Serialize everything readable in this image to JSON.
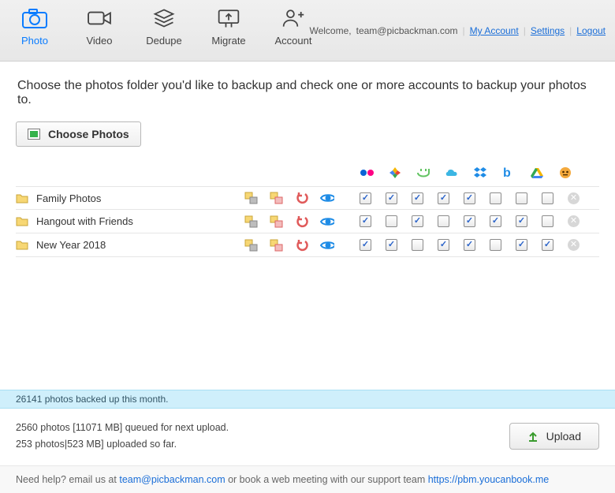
{
  "toolbar": {
    "tabs": [
      {
        "id": "photo",
        "label": "Photo",
        "active": true
      },
      {
        "id": "video",
        "label": "Video",
        "active": false
      },
      {
        "id": "dedupe",
        "label": "Dedupe",
        "active": false
      },
      {
        "id": "migrate",
        "label": "Migrate",
        "active": false
      },
      {
        "id": "account",
        "label": "Account",
        "active": false
      }
    ]
  },
  "top_right": {
    "welcome": "Welcome,",
    "email": "team@picbackman.com",
    "links": {
      "my_account": "My Account",
      "settings": "Settings",
      "logout": "Logout"
    }
  },
  "instruction": "Choose the photos folder you'd like to backup and check one or more accounts to backup your photos to.",
  "choose_button": "Choose Photos",
  "services": [
    {
      "id": "flickr",
      "name": "flickr-icon"
    },
    {
      "id": "google",
      "name": "google-photos-icon"
    },
    {
      "id": "smugmug",
      "name": "smugmug-icon"
    },
    {
      "id": "skydrive",
      "name": "skydrive-icon"
    },
    {
      "id": "dropbox",
      "name": "dropbox-icon"
    },
    {
      "id": "box",
      "name": "box-icon"
    },
    {
      "id": "drive",
      "name": "google-drive-icon"
    },
    {
      "id": "picmonkey",
      "name": "pic-icon"
    }
  ],
  "folders": [
    {
      "name": "Family Photos",
      "checks": [
        true,
        true,
        true,
        true,
        true,
        false,
        false,
        false
      ]
    },
    {
      "name": "Hangout with Friends",
      "checks": [
        true,
        false,
        true,
        false,
        true,
        true,
        true,
        false
      ]
    },
    {
      "name": "New Year 2018",
      "checks": [
        true,
        true,
        false,
        true,
        true,
        false,
        true,
        true
      ]
    }
  ],
  "footer": {
    "month_status": "26141 photos backed up this month.",
    "queue_line": "2560 photos [11071 MB] queued for next upload.",
    "uploaded_line": "253 photos|523 MB] uploaded so far.",
    "upload_button": "Upload",
    "help_prefix": "Need help? email us at ",
    "help_email": "team@picbackman.com",
    "help_mid": " or book a web meeting with our support team ",
    "help_url": "https://pbm.youcanbook.me"
  }
}
